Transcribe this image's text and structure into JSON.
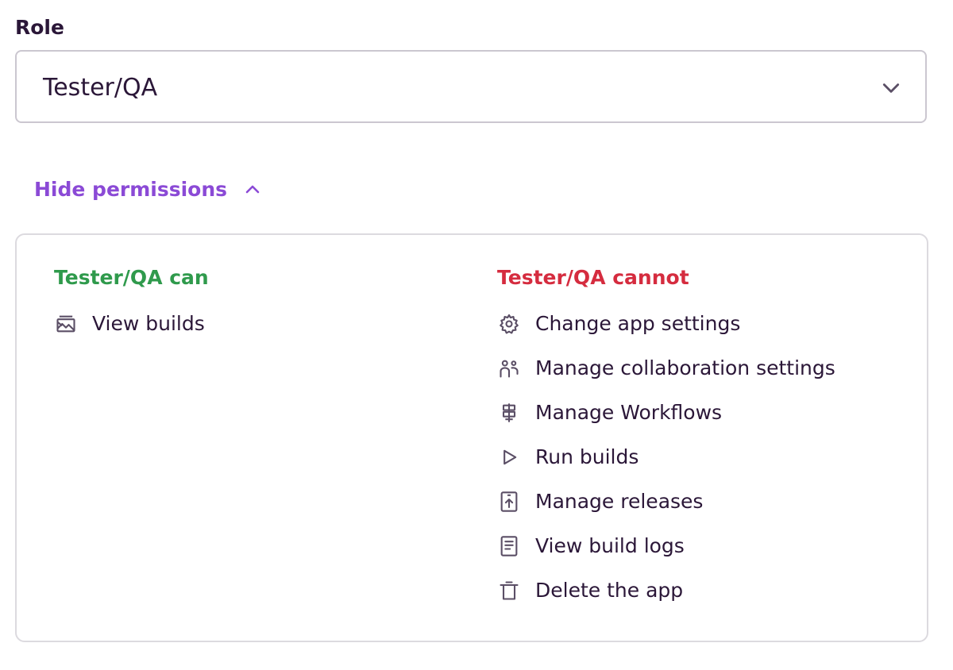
{
  "role": {
    "label": "Role",
    "selected_value": "Tester/QA"
  },
  "toggle": {
    "label": "Hide permissions"
  },
  "permissions": {
    "can_heading": "Tester/QA can",
    "cannot_heading": "Tester/QA cannot",
    "can": [
      {
        "label": "View builds",
        "icon": "builds-icon"
      }
    ],
    "cannot": [
      {
        "label": "Change app settings",
        "icon": "gear-icon"
      },
      {
        "label": "Manage collaboration settings",
        "icon": "people-icon"
      },
      {
        "label": "Manage Workflows",
        "icon": "workflow-icon"
      },
      {
        "label": "Run builds",
        "icon": "play-icon"
      },
      {
        "label": "Manage releases",
        "icon": "release-icon"
      },
      {
        "label": "View build logs",
        "icon": "log-icon"
      },
      {
        "label": "Delete the app",
        "icon": "trash-icon"
      }
    ]
  },
  "colors": {
    "text": "#2b1738",
    "accent": "#8b4ad6",
    "can": "#2f9a4c",
    "cannot": "#d52c3f",
    "icon": "#5b4f66"
  }
}
